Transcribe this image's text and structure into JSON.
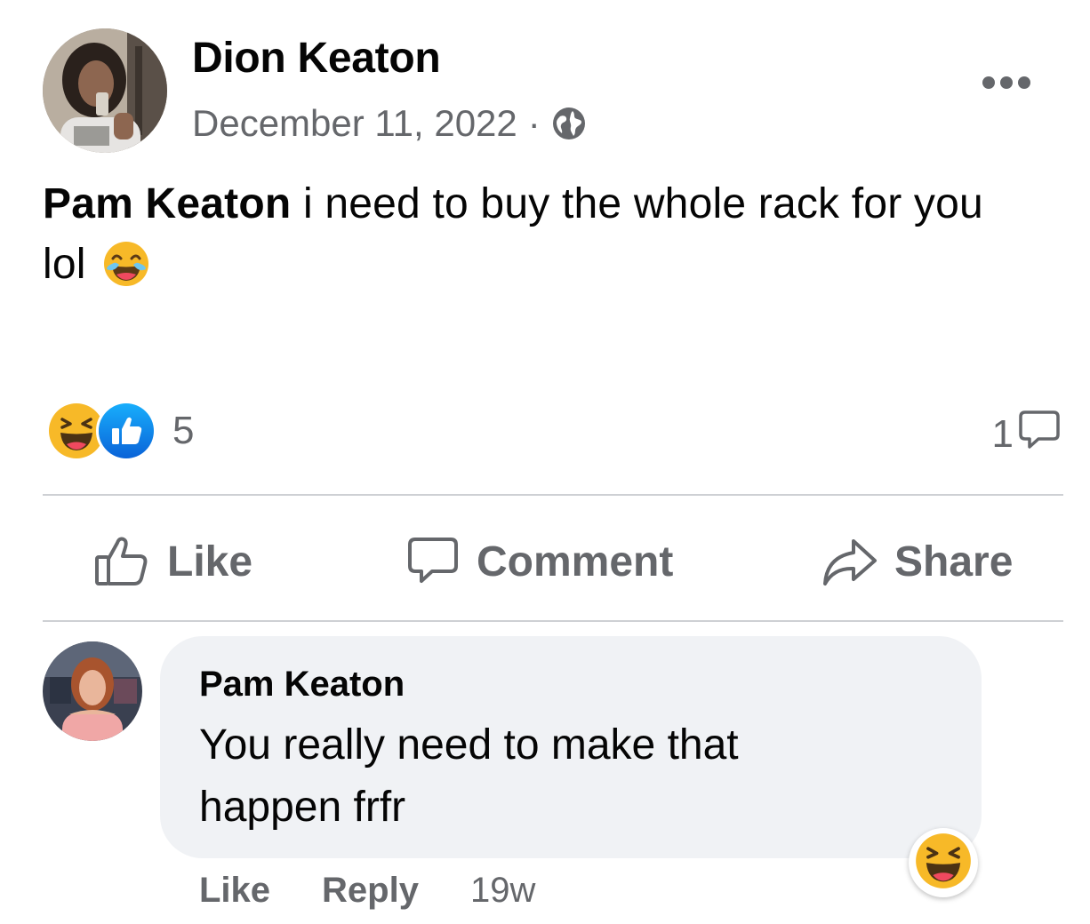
{
  "post": {
    "author": "Dion Keaton",
    "date": "December 11, 2022",
    "separator": "·",
    "visibility_icon": "globe-icon",
    "more_icon": "more-options-icon",
    "mention": "Pam Keaton",
    "text_line": " i need to buy the whole rack for you lol",
    "text_emoji": "laughing-crying-emoji"
  },
  "reactions": {
    "icons": [
      "haha-reaction-icon",
      "like-reaction-icon"
    ],
    "count": "5",
    "comment_count": "1",
    "comment_icon": "comment-bubble-icon"
  },
  "actions": {
    "like_label": "Like",
    "comment_label": "Comment",
    "share_label": "Share"
  },
  "comment": {
    "author": "Pam Keaton",
    "text": "You really need to make that happen frfr",
    "reaction_icon": "haha-reaction-icon",
    "like_label": "Like",
    "reply_label": "Reply",
    "time": "19w"
  },
  "colors": {
    "secondary_text": "#65676b",
    "divider": "#ced0d4",
    "bubble": "#f0f2f5",
    "like_blue": "#1877f2",
    "haha_yellow": "#f7b928"
  }
}
